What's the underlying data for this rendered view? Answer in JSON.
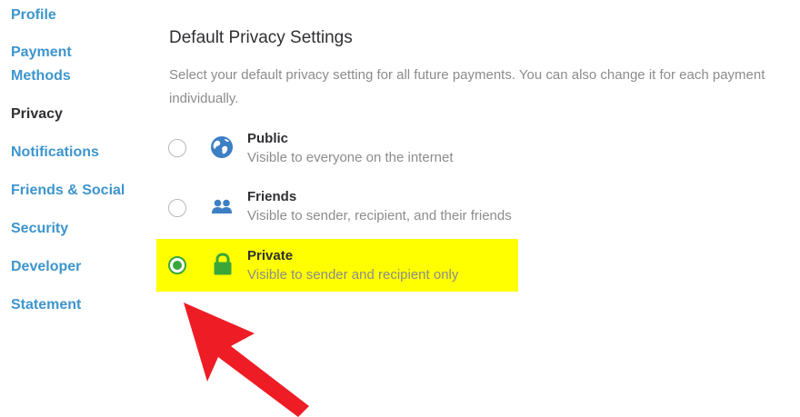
{
  "sidebar": {
    "items": [
      {
        "label": "Profile"
      },
      {
        "label": "Payment\nMethods"
      },
      {
        "label": "Privacy",
        "active": true
      },
      {
        "label": "Notifications"
      },
      {
        "label": "Friends & Social"
      },
      {
        "label": "Security"
      },
      {
        "label": "Developer"
      },
      {
        "label": "Statement"
      }
    ]
  },
  "main": {
    "title": "Default Privacy Settings",
    "description": "Select your default privacy setting for all future payments. You can also change it for each payment individually.",
    "options": [
      {
        "label": "Public",
        "description": "Visible to everyone on the internet",
        "icon": "globe-icon",
        "selected": false
      },
      {
        "label": "Friends",
        "description": "Visible to sender, recipient, and their friends",
        "icon": "friends-icon",
        "selected": false
      },
      {
        "label": "Private",
        "description": "Visible to sender and recipient only",
        "icon": "lock-icon",
        "selected": true
      }
    ]
  },
  "colors": {
    "link": "#3d95ce",
    "text": "#2f3033",
    "muted": "#8c8c8c",
    "highlight": "#ffff00",
    "selected_green": "#3aa63a",
    "annotation_arrow": "#ee1c24"
  }
}
